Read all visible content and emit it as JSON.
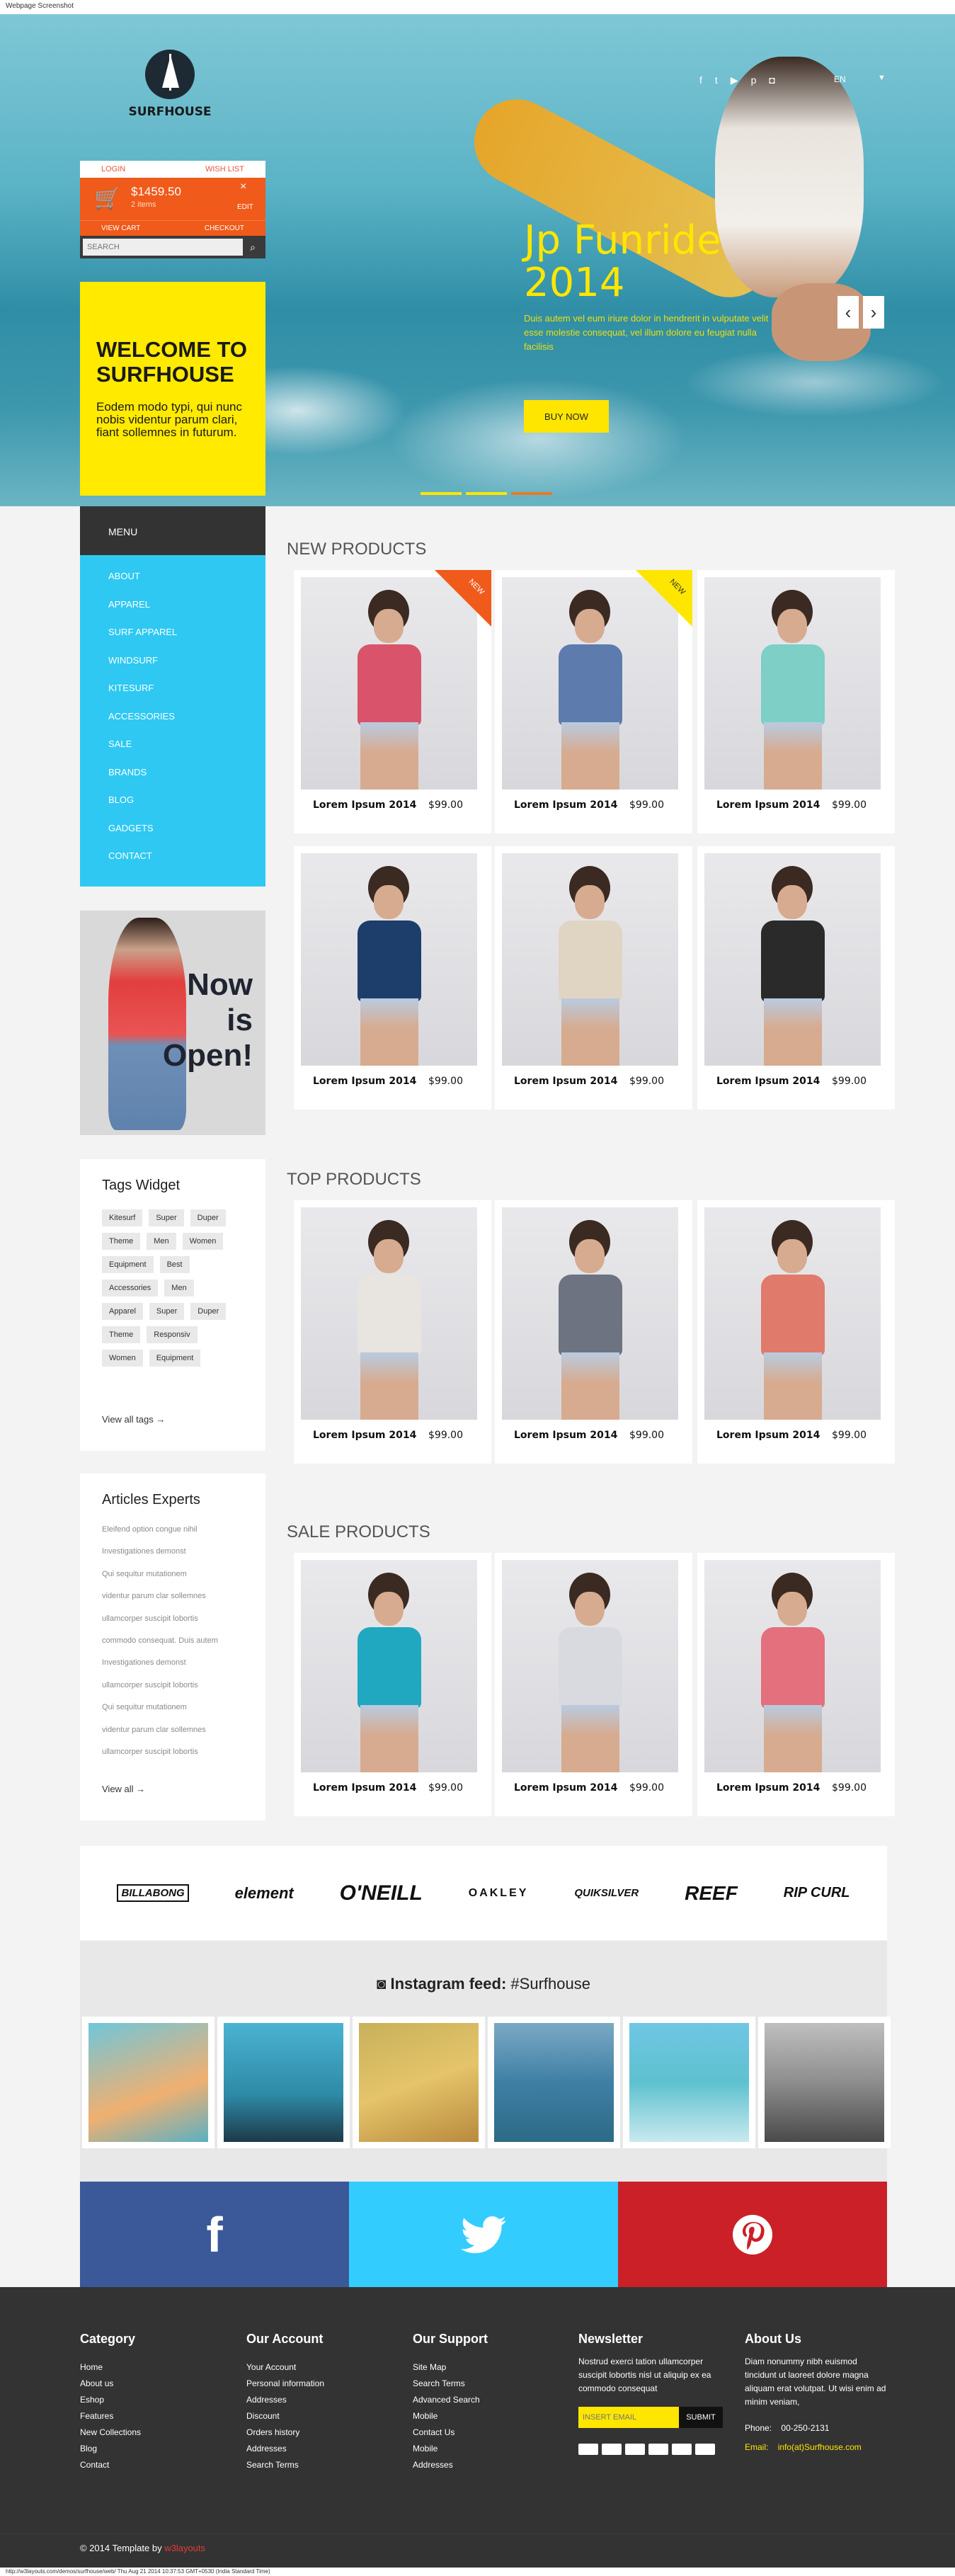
{
  "window": {
    "title": "Webpage Screenshot",
    "footer_caption": "http://w3layouts.com/demos/surfhouse/web/ Thu Aug 21 2014 10:37:53 GMT+0530 (India Standard Time)"
  },
  "brand": {
    "logo_text": "SURFHOUSE"
  },
  "header": {
    "language": "EN"
  },
  "cart": {
    "login": "LOGIN",
    "wishlist": "WISH LIST",
    "amount": "$1459.50",
    "items": "2 items",
    "edit": "EDIT",
    "view_cart": "VIEW CART",
    "checkout": "CHECKOUT",
    "search_placeholder": "SEARCH"
  },
  "welcome": {
    "title": "WELCOME TO SURFHOUSE",
    "text": "Eodem modo typi, qui nunc nobis videntur parum clari, fiant sollemnes in futurum."
  },
  "slider": {
    "title": "Jp Funride 2014",
    "text": "Duis autem vel eum iriure dolor in hendrerit in vulputate velit esse molestie consequat, vel illum dolore eu feugiat nulla facilisis",
    "button": "BUY NOW"
  },
  "menu": {
    "title": "MENU",
    "items": [
      "ABOUT",
      "APPAREL",
      "SURF APPAREL",
      "WINDSURF",
      "KITESURF",
      "ACCESSORIES",
      "SALE",
      "BRANDS",
      "BLOG",
      "GADGETS",
      "CONTACT"
    ]
  },
  "promo": {
    "line1": "Now",
    "line2": "is",
    "line3": "Open!"
  },
  "tags": {
    "title": "Tags Widget",
    "items": [
      "Kitesurf",
      "Super",
      "Duper",
      "Theme",
      "Men",
      "Women",
      "Equipment",
      "Best",
      "Accessories",
      "Men",
      "Apparel",
      "Super",
      "Duper",
      "Theme",
      "Responsiv",
      "Women",
      "Equipment"
    ],
    "view_all": "View all tags"
  },
  "articles": {
    "title": "Articles Experts",
    "items": [
      "Eleifend option congue nihil",
      "Investigationes demonst",
      "Qui sequitur mutationem",
      "videntur parum clar sollemnes",
      "ullamcorper suscipit lobortis",
      "commodo consequat. Duis autem",
      "Investigationes demonst",
      "ullamcorper suscipit lobortis",
      "Qui sequitur mutationem",
      "videntur parum clar sollemnes",
      "ullamcorper suscipit lobortis"
    ],
    "view_all": "View all"
  },
  "sections": {
    "new": "NEW PRODUCTS",
    "top": "TOP PRODUCTS",
    "sale": "SALE PRODUCTS"
  },
  "product": {
    "name": "Lorem Ipsum 2014",
    "price": "$99.00",
    "badge": "NEW"
  },
  "brands": [
    "BILLABONG",
    "element",
    "O'NEILL",
    "OAKLEY",
    "QUIKSILVER",
    "REEF",
    "RIP CURL"
  ],
  "instagram": {
    "label": "Instagram feed:",
    "tag": "#Surfhouse"
  },
  "social_buttons": {
    "facebook": "f",
    "colors": {
      "facebook": "#3b5998",
      "twitter": "#33ccff",
      "pinterest": "#cb2027"
    }
  },
  "footer": {
    "category": {
      "title": "Category",
      "items": [
        "Home",
        "About us",
        "Eshop",
        "Features",
        "New Collections",
        "Blog",
        "Contact"
      ]
    },
    "account": {
      "title": "Our Account",
      "items": [
        "Your Account",
        "Personal information",
        "Addresses",
        "Discount",
        "Orders history",
        "Addresses",
        "Search Terms"
      ]
    },
    "support": {
      "title": "Our Support",
      "items": [
        "Site Map",
        "Search Terms",
        "Advanced Search",
        "Mobile",
        "Contact Us",
        "Mobile",
        "Addresses"
      ]
    },
    "newsletter": {
      "title": "Newsletter",
      "text": "Nostrud exerci tation ullamcorper suscipit lobortis nisl ut aliquip ex ea commodo consequat",
      "placeholder": "INSERT EMAIL",
      "submit": "SUBMIT"
    },
    "about": {
      "title": "About Us",
      "text": "Diam nonummy nibh euismod tincidunt ut laoreet dolore magna aliquam erat volutpat. Ut wisi enim ad minim veniam,",
      "phone_label": "Phone:",
      "phone": "00-250-2131",
      "email_label": "Email:",
      "email": "info(at)Surfhouse.com"
    },
    "copyright": "© 2014 Template by",
    "copyright_link": "w3layouts"
  },
  "colors": {
    "accent_yellow": "#ffe600",
    "accent_orange": "#f05a1a",
    "menu_blue": "#2ec8f2",
    "dark": "#333333"
  }
}
